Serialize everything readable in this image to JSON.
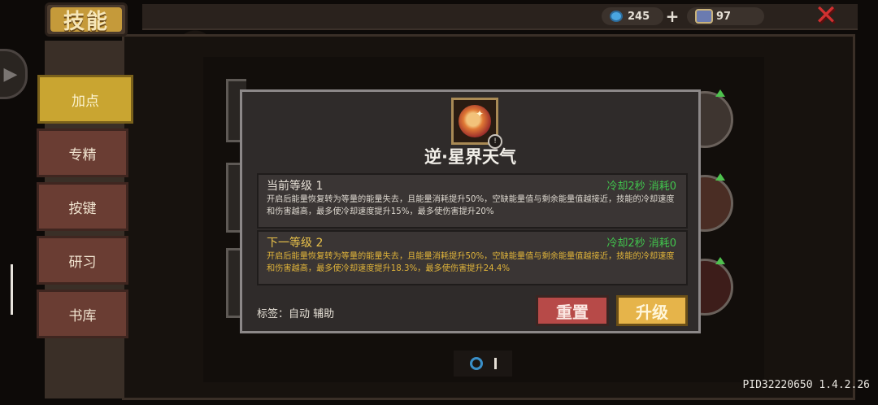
{
  "title": "技能",
  "currency": {
    "gems": "245",
    "tickets": "97",
    "plus_label": "+"
  },
  "close_label": "✕",
  "nav": [
    {
      "label": "加点",
      "active": true
    },
    {
      "label": "专精",
      "active": false
    },
    {
      "label": "按键",
      "active": false
    },
    {
      "label": "研习",
      "active": false
    },
    {
      "label": "书库",
      "active": false
    }
  ],
  "modal": {
    "skill_name": "逆·星界天气",
    "info_icon": "!",
    "current": {
      "header": "当前等级 1",
      "cost": "冷却2秒 消耗0",
      "desc": "开启后能量恢复转为等量的能量失去，且能量消耗提升50%，空缺能量值与剩余能量值越接近，技能的冷却速度和伤害越高，最多使冷却速度提升15%，最多使伤害提升20%"
    },
    "next": {
      "header": "下一等级 2",
      "cost": "冷却2秒 消耗0",
      "desc": "开启后能量恢复转为等量的能量失去，且能量消耗提升50%，空缺能量值与剩余能量值越接近，技能的冷却速度和伤害越高，最多使冷却速度提升18.3%，最多使伤害提升24.4%"
    },
    "tags": "标签：自动 辅助",
    "reset_label": "重置",
    "upgrade_label": "升级"
  },
  "pid": "PID32220650 1.4.2.26",
  "colors": {
    "accent_gold": "#c9a531",
    "reset_red": "#b74a48",
    "upgrade_yellow": "#e6b44a",
    "cost_green": "#41c44d"
  }
}
